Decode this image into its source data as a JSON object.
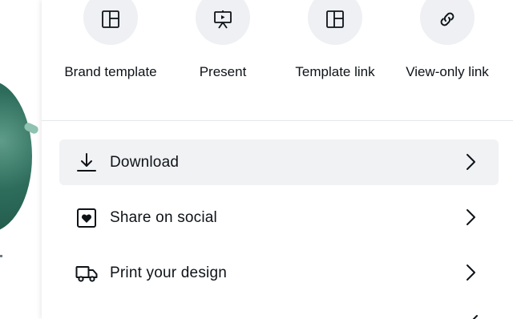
{
  "quick_actions": [
    {
      "label": "Brand template",
      "icon": "layout-icon"
    },
    {
      "label": "Present",
      "icon": "presentation-icon"
    },
    {
      "label": "Template link",
      "icon": "layout-icon"
    },
    {
      "label": "View-only link",
      "icon": "link-icon"
    }
  ],
  "menu": [
    {
      "label": "Download",
      "icon": "download-icon",
      "active": true
    },
    {
      "label": "Share on social",
      "icon": "heart-box-icon",
      "active": false
    },
    {
      "label": "Print your design",
      "icon": "truck-icon",
      "active": false
    }
  ],
  "colors": {
    "text": "#0e1318",
    "circle_bg": "#eef0f3",
    "active_bg": "#f1f2f4",
    "divider": "#e4e6ea",
    "canvas_green": "#2e6d5b"
  }
}
